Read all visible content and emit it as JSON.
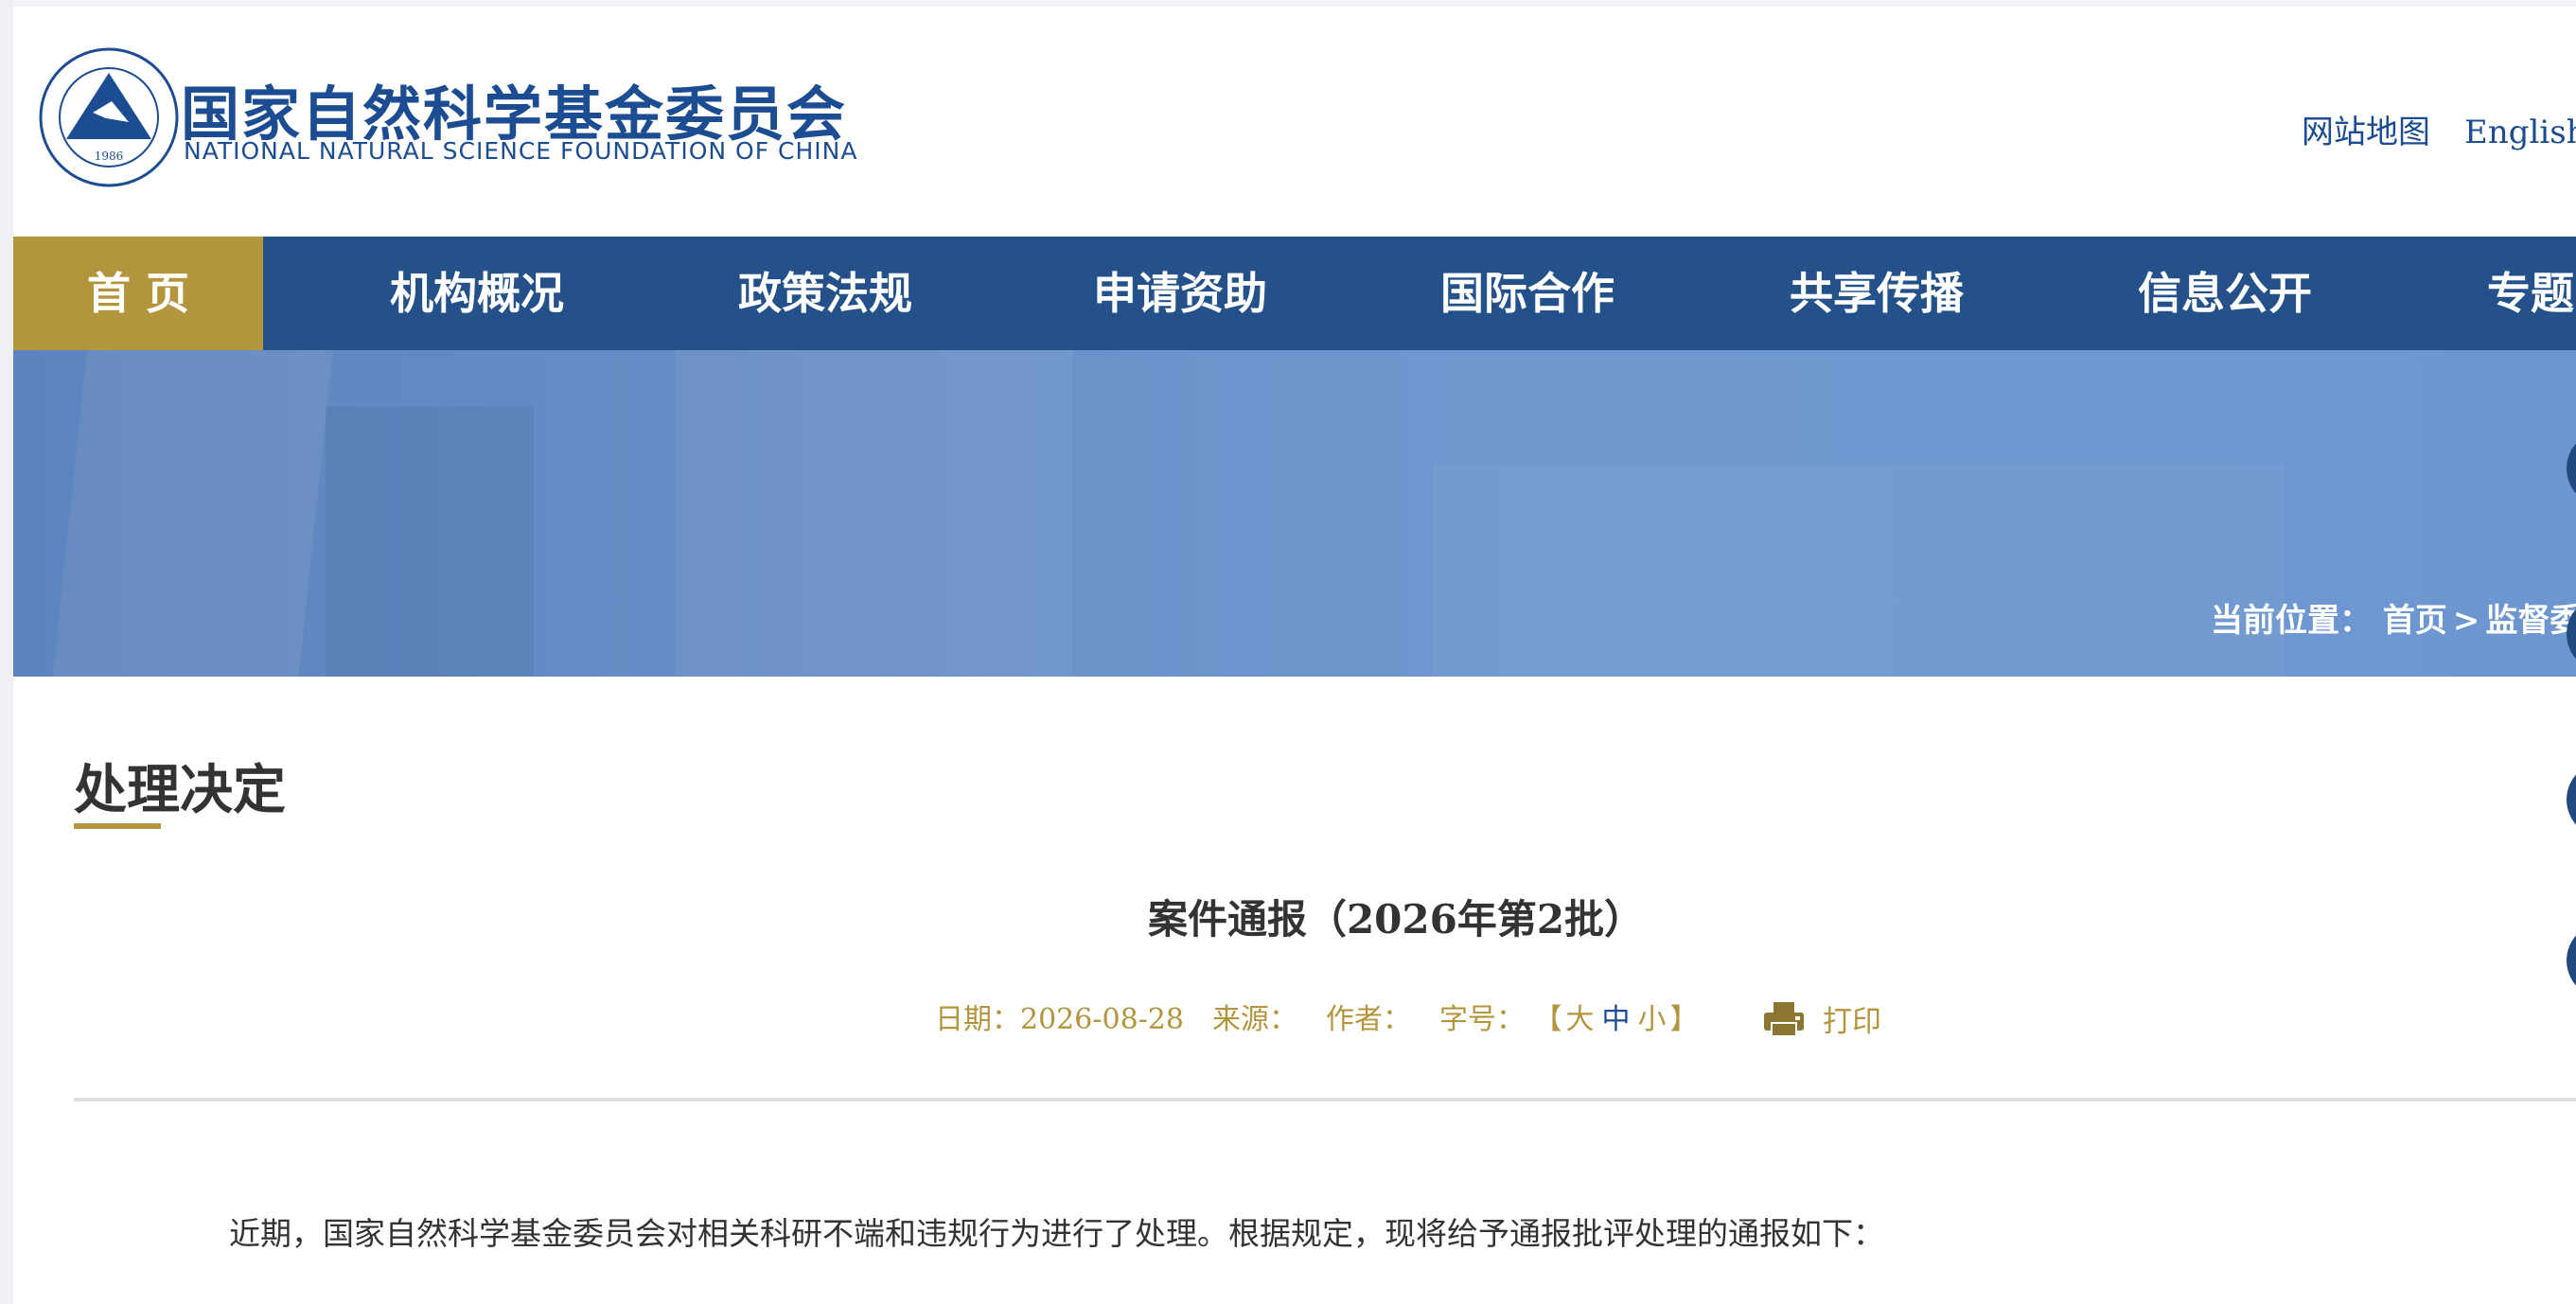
{
  "header": {
    "emblem_year": "1986",
    "logo_cn": "国家自然科学基金委员会",
    "logo_en": "NATIONAL NATURAL SCIENCE FOUNDATION OF CHINA",
    "links": [
      "网站地图",
      "English"
    ]
  },
  "nav": {
    "items": [
      "首 页",
      "机构概况",
      "政策法规",
      "申请资助",
      "国际合作",
      "共享传播",
      "信息公开",
      "专题"
    ]
  },
  "banner": {
    "breadcrumb_label": "当前位置：",
    "breadcrumb_home": "首页",
    "breadcrumb_sep": ">",
    "breadcrumb_current": "监督委"
  },
  "article": {
    "section_title": "处理决定",
    "title": "案件通报（2026年第2批）",
    "date": "日期：2026-08-28",
    "source": "来源：",
    "author": "作者：",
    "font_size_label": "字号：",
    "bracket_open": "【",
    "size_large": "大",
    "size_medium": "中",
    "size_small": "小",
    "bracket_close": "】",
    "print": "打印",
    "body": "近期，国家自然科学基金委员会对相关科研不端和违规行为进行了处理。根据规定，现将给予通报批评处理的通报如下："
  },
  "colors": {
    "brand_blue": "#1c4c91",
    "nav_blue": "#245189",
    "gold": "#b3953d"
  }
}
